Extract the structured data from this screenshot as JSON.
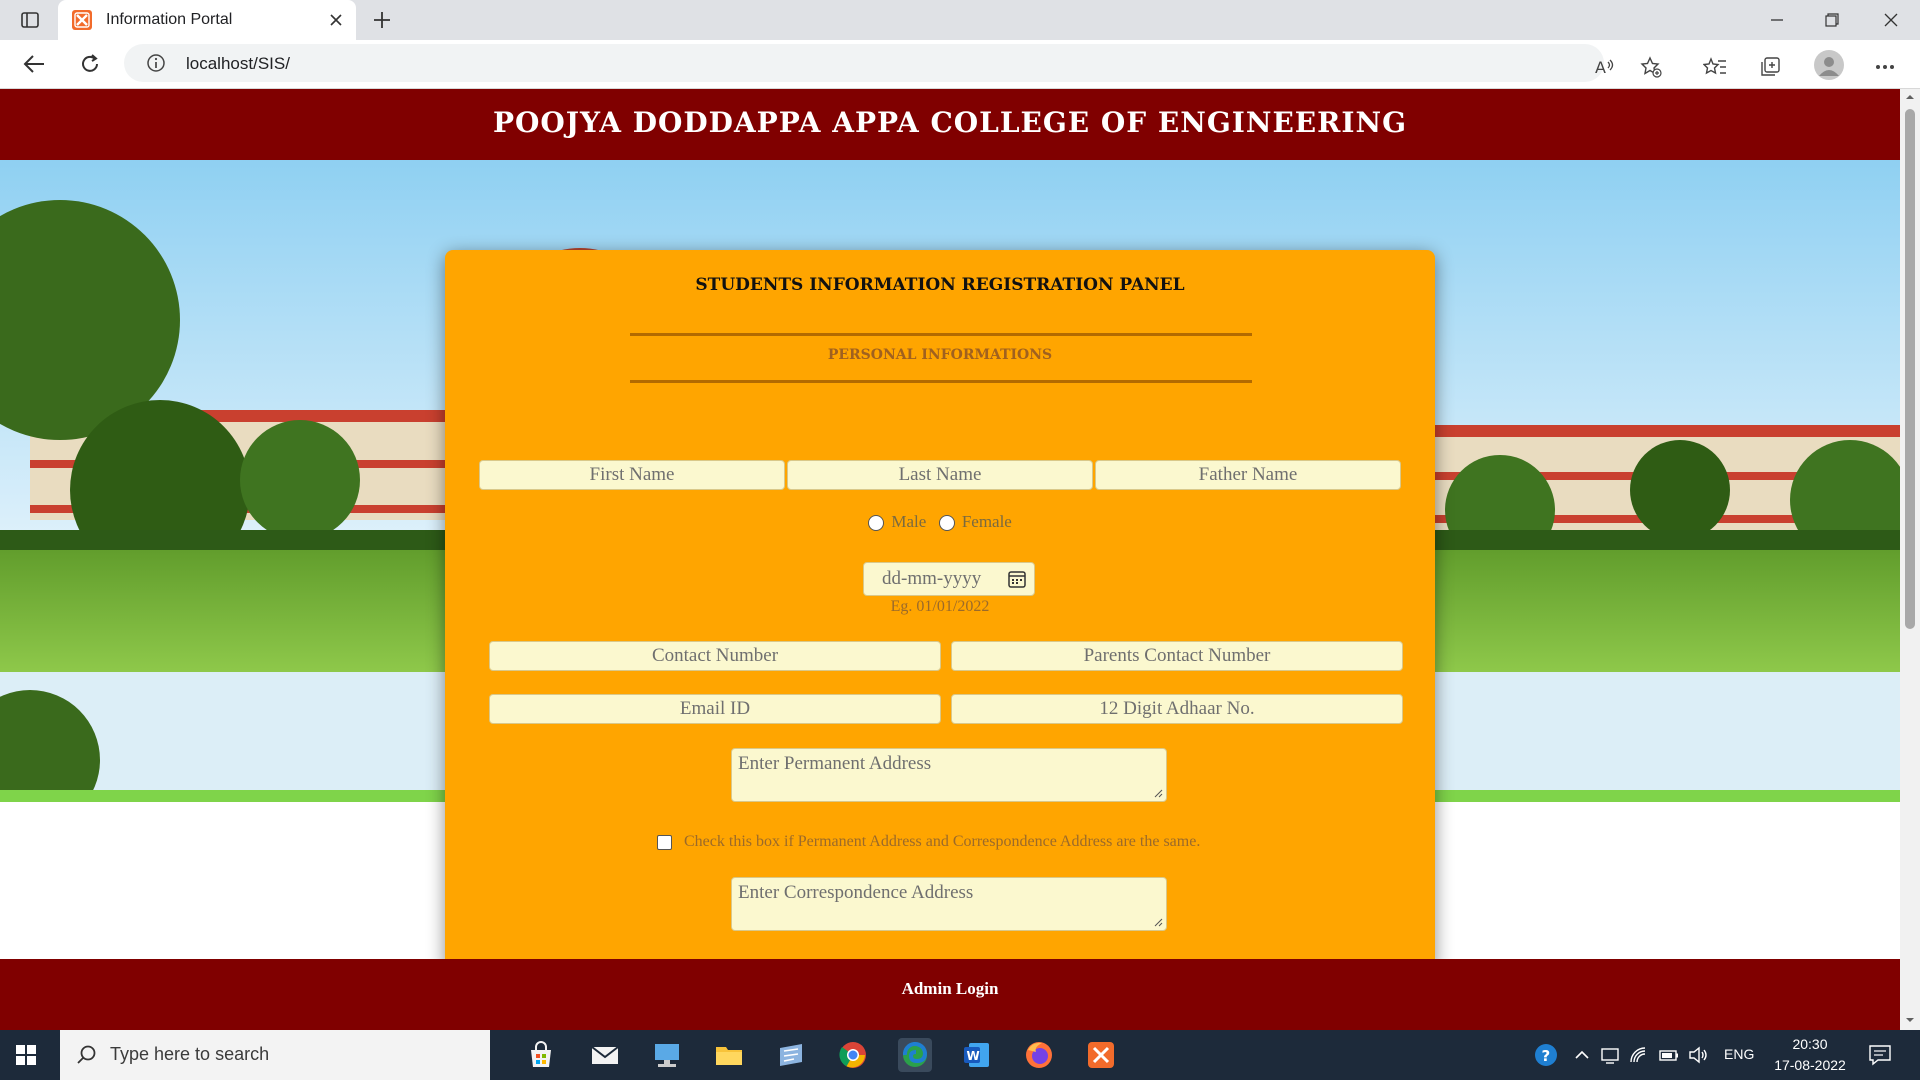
{
  "browser": {
    "tab_title": "Information Portal",
    "url": "localhost/SIS/"
  },
  "page": {
    "college_name": "POOJYA DODDAPPA APPA COLLEGE OF ENGINEERING",
    "footer_link": "Admin Login"
  },
  "form": {
    "panel_title": "STUDENTS INFORMATION REGISTRATION PANEL",
    "section_title": "PERSONAL INFORMATIONS",
    "first_name_placeholder": "First Name",
    "last_name_placeholder": "Last Name",
    "father_name_placeholder": "Father Name",
    "gender_options": [
      "Male",
      "Female"
    ],
    "dob_placeholder": "dd-mm-yyyy",
    "dob_hint": "Eg. 01/01/2022",
    "contact_placeholder": "Contact Number",
    "parents_contact_placeholder": "Parents Contact Number",
    "email_placeholder": "Email ID",
    "adhaar_placeholder": "12 Digit Adhaar No.",
    "permanent_address_placeholder": "Enter Permanent Address",
    "same_address_label": "Check this box if Permanent Address and Correspondence Address are the same.",
    "correspondence_address_placeholder": "Enter Correspondence Address"
  },
  "taskbar": {
    "search_placeholder": "Type here to search",
    "language": "ENG",
    "time": "20:30",
    "date": "17-08-2022",
    "apps": [
      "store-icon",
      "mail-icon",
      "network-drive-icon",
      "file-explorer-icon",
      "ssh-client-icon",
      "chrome-icon",
      "edge-icon",
      "word-icon",
      "firefox-icon",
      "xampp-icon"
    ]
  },
  "colors": {
    "header_maroon": "#800000",
    "panel_orange": "#ffa500",
    "input_cream": "#fbf8cf"
  }
}
